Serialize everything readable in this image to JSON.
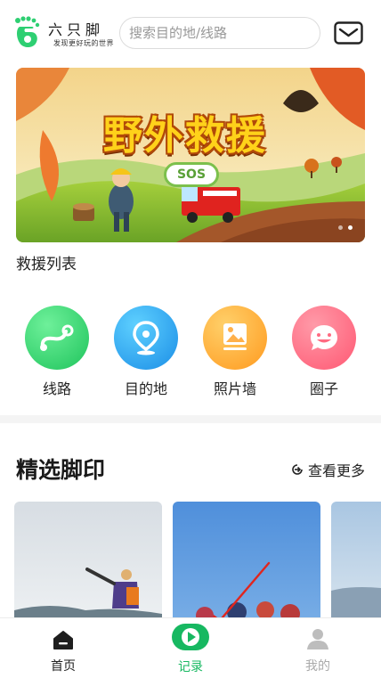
{
  "header": {
    "brand_name": "六只脚",
    "brand_slogan": "发现更好玩的世界",
    "search_placeholder": "搜索目的地/线路"
  },
  "banner": {
    "title": "野外救援",
    "badge": "SOS",
    "dots": 2,
    "active_dot": 1
  },
  "rescue_list_label": "救援列表",
  "categories": [
    {
      "label": "线路",
      "icon": "route-icon",
      "color": "#2fd56f"
    },
    {
      "label": "目的地",
      "icon": "location-pin-icon",
      "color": "#2a9df0"
    },
    {
      "label": "照片墙",
      "icon": "photo-icon",
      "color": "#ffa72c"
    },
    {
      "label": "圈子",
      "icon": "smile-chat-icon",
      "color": "#ff6b82"
    }
  ],
  "featured": {
    "title": "精选脚印",
    "more_label": "查看更多"
  },
  "tabbar": {
    "home": "首页",
    "record": "记录",
    "mine": "我的",
    "accent": "#17b861"
  }
}
